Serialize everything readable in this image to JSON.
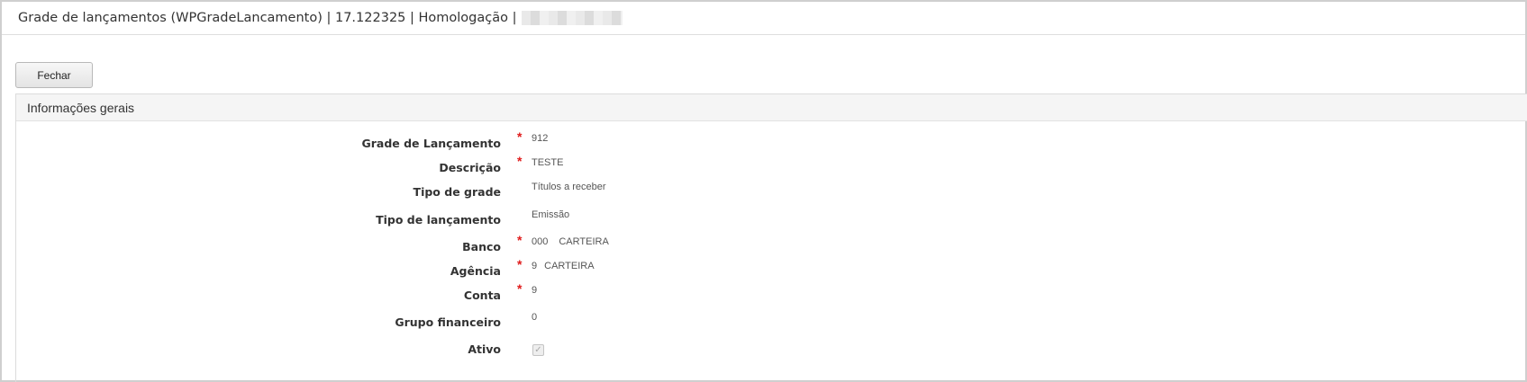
{
  "window": {
    "title": "Grade de lançamentos (WPGradeLancamento) | 17.122325 | Homologação |"
  },
  "toolbar": {
    "close_label": "Fechar"
  },
  "section": {
    "title": "Informações gerais"
  },
  "fields": {
    "grade": {
      "label": "Grade de Lançamento",
      "value": "912",
      "required": true
    },
    "descricao": {
      "label": "Descrição",
      "value": "TESTE",
      "required": true
    },
    "tipo_grade": {
      "label": "Tipo de grade",
      "value": "Títulos a receber",
      "required": false
    },
    "tipo_lancamento": {
      "label": "Tipo de lançamento",
      "value": "Emissão",
      "required": false
    },
    "banco": {
      "label": "Banco",
      "code": "000",
      "name": "CARTEIRA",
      "required": true
    },
    "agencia": {
      "label": "Agência",
      "code": "9",
      "name": "CARTEIRA",
      "required": true
    },
    "conta": {
      "label": "Conta",
      "value": "9",
      "required": true
    },
    "grupo_financeiro": {
      "label": "Grupo financeiro",
      "value": "0",
      "required": false
    },
    "ativo": {
      "label": "Ativo",
      "checked": true,
      "required": false
    }
  },
  "required_marker": "*",
  "check_glyph": "✓"
}
